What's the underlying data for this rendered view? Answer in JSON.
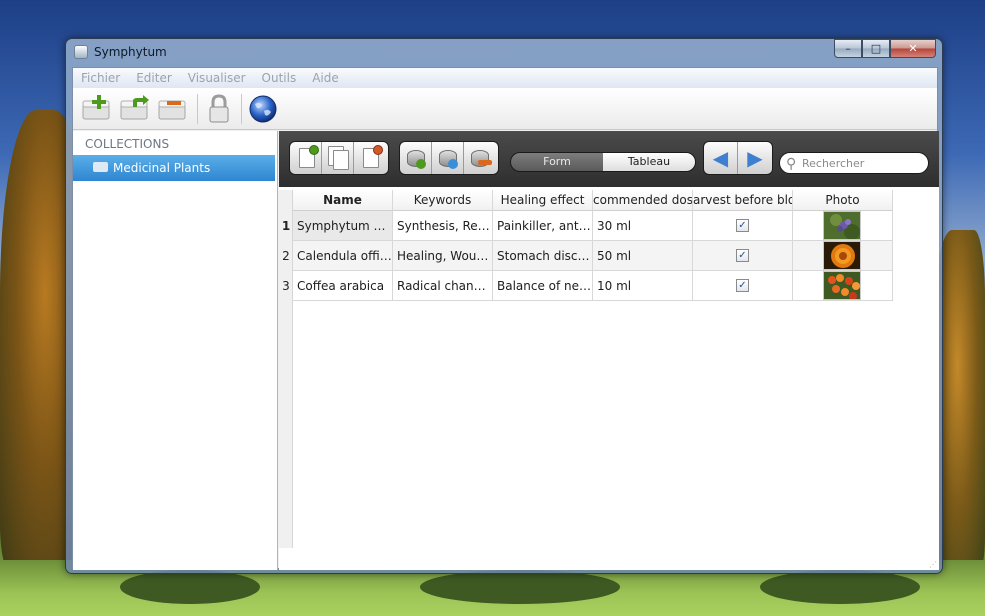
{
  "window": {
    "title": "Symphytum",
    "min_glyph": "–",
    "max_glyph": "□",
    "close_glyph": "✕"
  },
  "menu": [
    "Fichier",
    "Editer",
    "Visualiser",
    "Outils",
    "Aide"
  ],
  "toolbar": {
    "icons": [
      "new-collection-icon",
      "duplicate-collection-icon",
      "delete-collection-icon",
      "lock-icon",
      "globe-icon"
    ]
  },
  "sidebar": {
    "header": "COLLECTIONS",
    "items": [
      {
        "label": "Medicinal Plants",
        "selected": true
      }
    ]
  },
  "content_toolbar": {
    "record_icons": [
      "new-record-icon",
      "duplicate-record-icon",
      "delete-record-icon"
    ],
    "field_icons": [
      "add-field-icon",
      "edit-field-icon",
      "delete-field-icon"
    ],
    "view_modes": [
      "Form",
      "Tableau"
    ],
    "active_view": "Tableau",
    "nav_prev": "◀",
    "nav_next": "▶",
    "search_icon_glyph": "⚲",
    "search_placeholder": "Rechercher"
  },
  "table": {
    "columns": [
      "Name",
      "Keywords",
      "Healing effect",
      "commended dosa",
      "arvest before bloo",
      "Photo"
    ],
    "rows": [
      {
        "num": "1",
        "name": "Symphytum off...",
        "keywords": "Synthesis, Reco...",
        "healing": "Painkiller, anti-i...",
        "dosage": "30 ml",
        "harvest": true,
        "photo": "comfrey-photo"
      },
      {
        "num": "2",
        "name": "Calendula offici...",
        "keywords": "Healing, Woun...",
        "healing": "Stomach disco...",
        "dosage": "50 ml",
        "harvest": true,
        "photo": "calendula-photo"
      },
      {
        "num": "3",
        "name": "Coffea arabica",
        "keywords": "Radical change,...",
        "healing": "Balance of neur...",
        "dosage": "10 ml",
        "harvest": true,
        "photo": "coffee-photo"
      }
    ]
  },
  "colors": {
    "selection": "#2f86d1",
    "toolbar_dark": "#3a3a3a",
    "nav_arrow": "#3f7fd0"
  }
}
